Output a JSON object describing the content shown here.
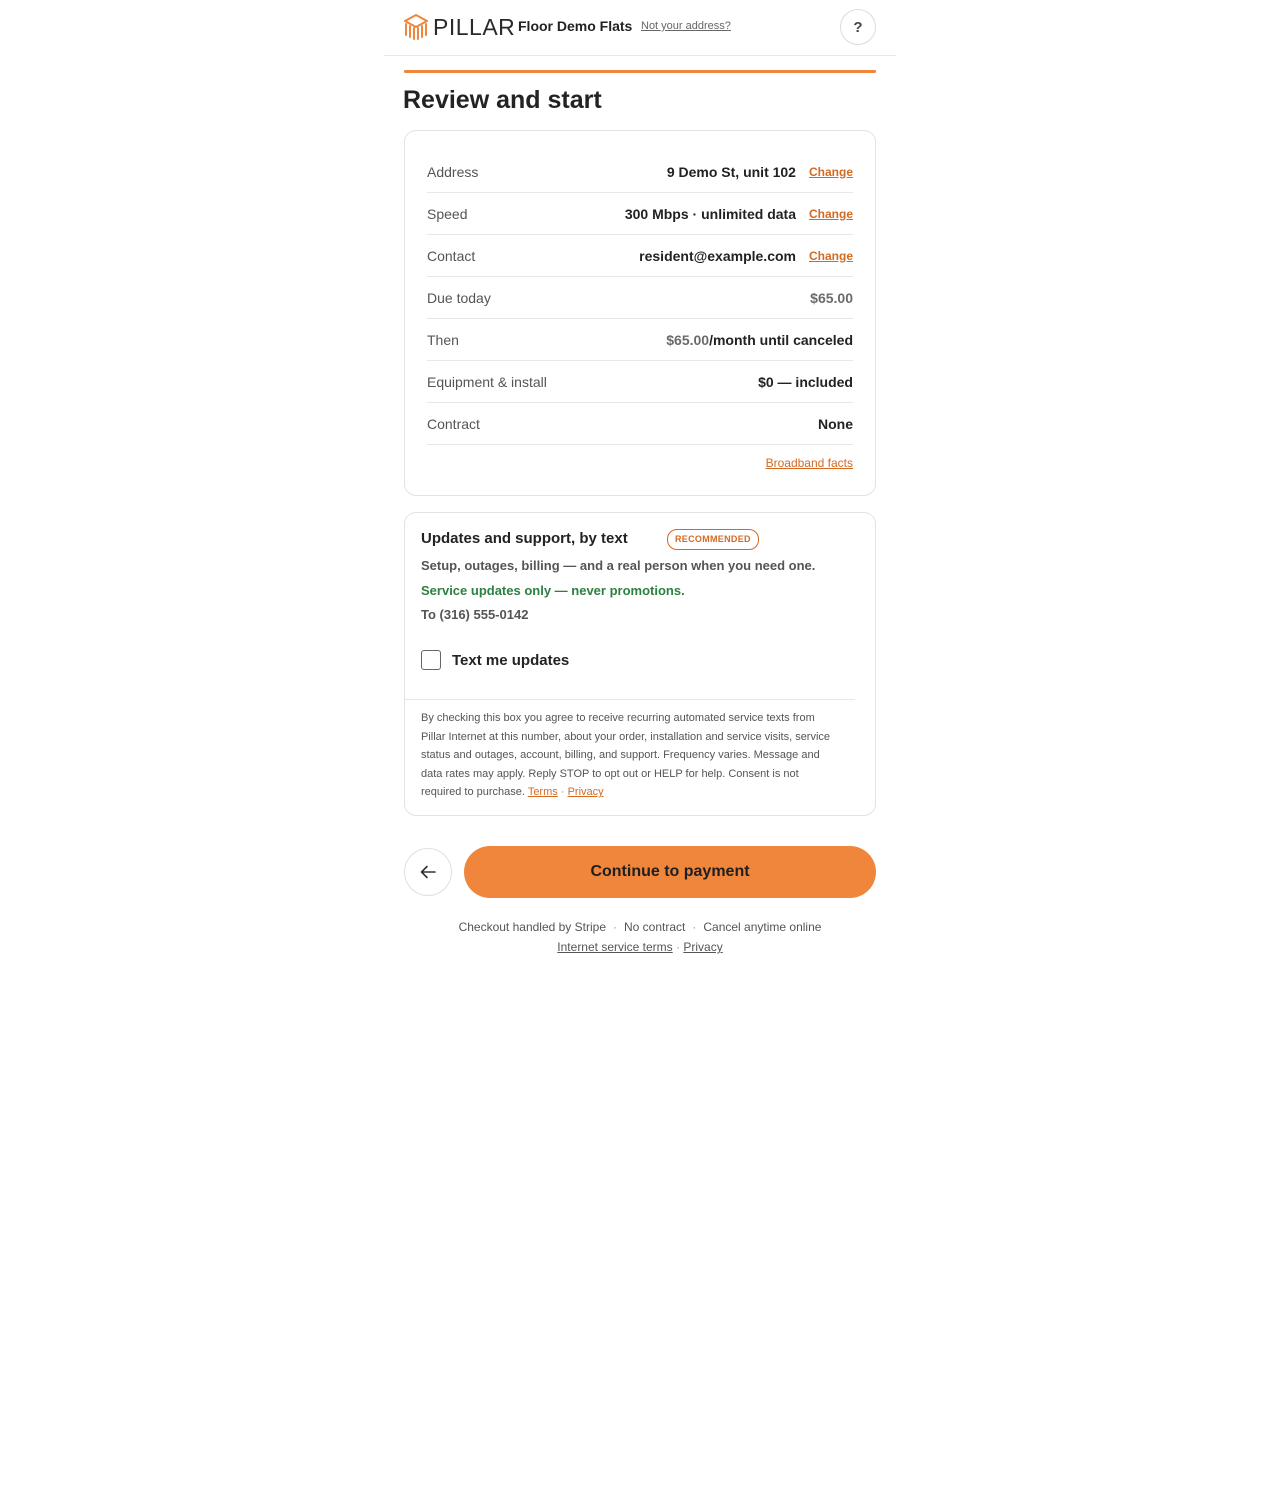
{
  "header": {
    "brand": "PILLAR",
    "property_name": "Floor Demo Flats",
    "not_address_link": "Not your address?",
    "help_label": "?"
  },
  "progress": {
    "fraction": 1.0,
    "color": "#ef863c"
  },
  "page_title": "Review and start",
  "summary": {
    "rows": [
      {
        "label": "Address",
        "value": "9 Demo St, unit 102",
        "change": "Change"
      },
      {
        "label": "Speed",
        "value": "300 Mbps · unlimited data",
        "change": "Change"
      },
      {
        "label": "Contact",
        "value": "resident@example.com",
        "change": "Change"
      },
      {
        "label": "Due today",
        "value": "$65.00"
      },
      {
        "label": "Then",
        "value_price": "$65.00",
        "value_suffix": "/month until canceled"
      },
      {
        "label": "Equipment & install",
        "value": "$0 — included"
      },
      {
        "label": "Contract",
        "value": "None"
      }
    ],
    "broadband_facts_link": "Broadband facts"
  },
  "sms": {
    "title": "Updates and support, by text",
    "badge": "RECOMMENDED",
    "description": "Setup, outages, billing — and a real person when you need one.",
    "service_note": "Service updates only — never promotions.",
    "phone_line": "To (316) 555-0142",
    "checkbox_label": "Text me updates",
    "checkbox_checked": false,
    "legal_text": "By checking this box you agree to receive recurring automated service texts from Pillar Internet at this number, about your order, installation and service visits, service status and outages, account, billing, and support. Frequency varies. Message and data rates may apply. Reply STOP to opt out or HELP for help. Consent is not required to purchase.",
    "terms_link": "Terms",
    "privacy_link": "Privacy",
    "link_separator": "·"
  },
  "actions": {
    "back_icon": "arrow-left-icon",
    "continue_label": "Continue to payment"
  },
  "footer": {
    "items": [
      "Checkout handled by Stripe",
      "No contract",
      "Cancel anytime online"
    ],
    "dot": "·",
    "service_terms_link": "Internet service terms",
    "privacy_link": "Privacy",
    "link_separator": "·"
  },
  "colors": {
    "accent": "#ef863c",
    "link": "#d46a22",
    "success": "#2e8040"
  }
}
